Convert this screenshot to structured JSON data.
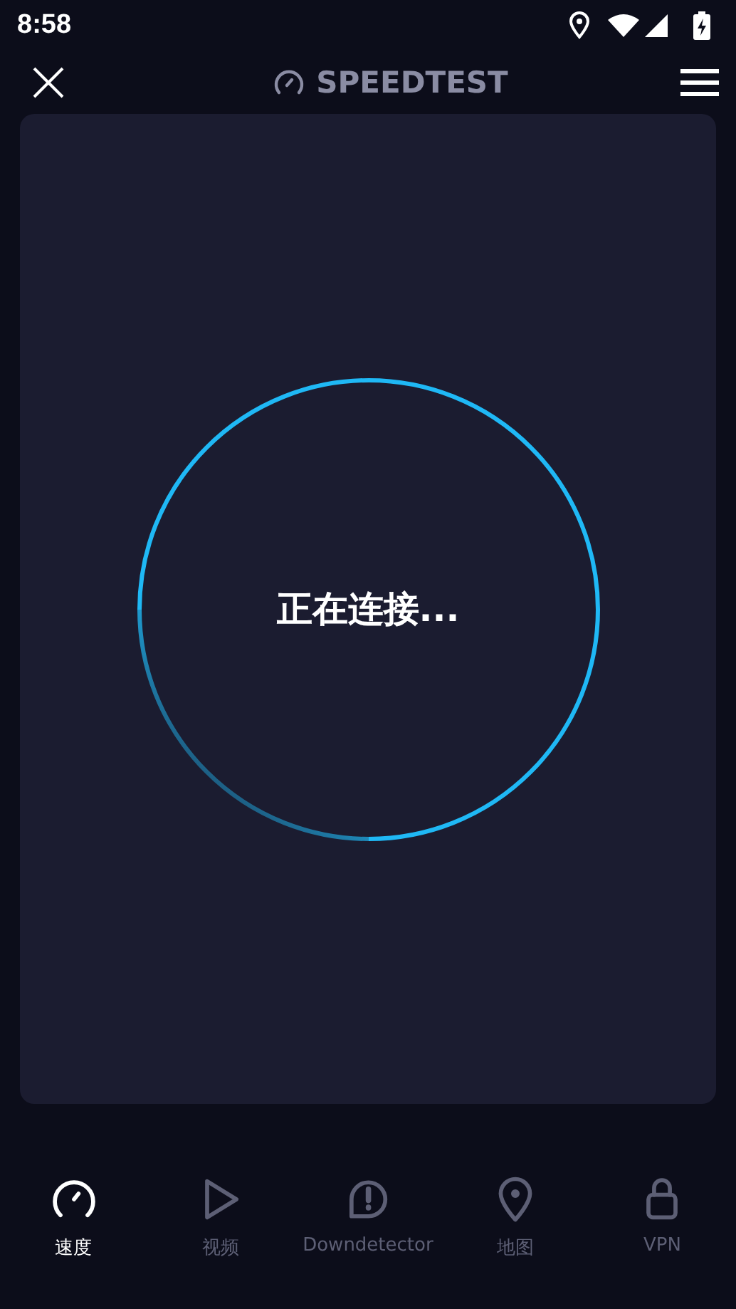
{
  "status_bar": {
    "time": "8:58"
  },
  "header": {
    "title": "SPEEDTEST"
  },
  "test": {
    "status": "正在连接..."
  },
  "tabs": [
    {
      "kind": "speed",
      "label": "速度",
      "selected": true
    },
    {
      "kind": "video",
      "label": "视频",
      "selected": false
    },
    {
      "kind": "alert",
      "label": "Downdetector",
      "selected": false
    },
    {
      "kind": "map",
      "label": "地图",
      "selected": false
    },
    {
      "kind": "vpn",
      "label": "VPN",
      "selected": false
    }
  ]
}
